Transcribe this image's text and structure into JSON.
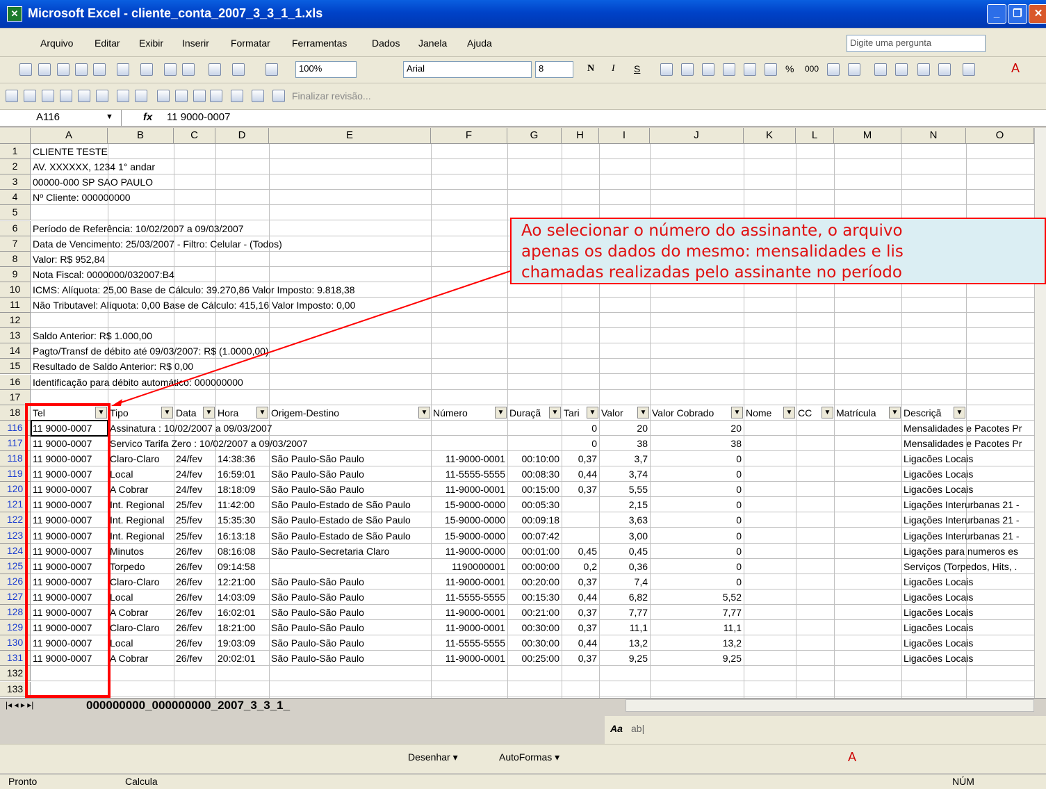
{
  "window": {
    "title": "Microsoft Excel - cliente_conta_2007_3_3_1_1.xls"
  },
  "menu": [
    "Arquivo",
    "Editar",
    "Exibir",
    "Inserir",
    "Formatar",
    "Ferramentas",
    "Dados",
    "Janela",
    "Ajuda"
  ],
  "help_placeholder": "Digite uma pergunta",
  "toolbar": {
    "zoom": "100%",
    "font": "Arial",
    "size": "8",
    "review": "Finalizar revisão..."
  },
  "formula": {
    "cell": "A116",
    "fx": "fx",
    "value": "11 9000-0007"
  },
  "columns": [
    "A",
    "B",
    "C",
    "D",
    "E",
    "F",
    "G",
    "H",
    "I",
    "J",
    "K",
    "L",
    "M",
    "N",
    "O"
  ],
  "rows": [
    {
      "n": "1",
      "a": "CLIENTE TESTE"
    },
    {
      "n": "2",
      "a": "AV. XXXXXX, 1234 1° andar"
    },
    {
      "n": "3",
      "a": "00000-000 SP SAO PAULO"
    },
    {
      "n": "4",
      "a": "Nº Cliente: 000000000"
    },
    {
      "n": "5",
      "a": ""
    },
    {
      "n": "6",
      "a": "Período de Referência: 10/02/2007 a 09/03/2007"
    },
    {
      "n": "7",
      "a": "Data de Vencimento: 25/03/2007 - Filtro: Celular - (Todos)"
    },
    {
      "n": "8",
      "a": "Valor: R$ 952,84"
    },
    {
      "n": "9",
      "a": "Nota Fiscal: 0000000/032007:B4"
    },
    {
      "n": "10",
      "a": "ICMS: Alíquota: 25,00 Base de Cálculo: 39.270,86 Valor Imposto: 9.818,38"
    },
    {
      "n": "11",
      "a": "Não Tributavel: Alíquota: 0,00 Base de Cálculo: 415,16 Valor Imposto: 0,00"
    },
    {
      "n": "12",
      "a": ""
    },
    {
      "n": "13",
      "a": "Saldo Anterior: R$ 1.000,00"
    },
    {
      "n": "14",
      "a": "Pagto/Transf de débito até 09/03/2007: R$ (1.0000,00)"
    },
    {
      "n": "15",
      "a": "Resultado de Saldo Anterior: R$ 0,00"
    },
    {
      "n": "16",
      "a": "Identificação para débito automático: 000000000"
    },
    {
      "n": "17",
      "a": ""
    }
  ],
  "header_row": {
    "n": "18",
    "cols": [
      "Tel",
      "Tipo",
      "Data",
      "Hora",
      "Origem-Destino",
      "Número",
      "Duraçã",
      "Tari",
      "Valor",
      "Valor Cobrado",
      "Nome",
      "CC",
      "Matrícula",
      "Descriçã"
    ]
  },
  "data_rows": [
    {
      "n": "116",
      "tel": "11 9000-0007",
      "tipo": "Assinatura : 10/02/2007 a 09/03/2007",
      "data": "",
      "hora": "",
      "orig": "",
      "num": "",
      "dur": "",
      "tar": "0",
      "val": "20",
      "cob": "20",
      "desc": "Mensalidades e Pacotes Pr"
    },
    {
      "n": "117",
      "tel": "11 9000-0007",
      "tipo": "Servico Tarifa Zero : 10/02/2007 a 09/03/2007",
      "data": "",
      "hora": "",
      "orig": "",
      "num": "",
      "dur": "",
      "tar": "0",
      "val": "38",
      "cob": "38",
      "desc": "Mensalidades e Pacotes Pr"
    },
    {
      "n": "118",
      "tel": "11 9000-0007",
      "tipo": "Claro-Claro",
      "data": "24/fev",
      "hora": "14:38:36",
      "orig": "São Paulo-São Paulo",
      "num": "11-9000-0001",
      "dur": "00:10:00",
      "tar": "0,37",
      "val": "3,7",
      "cob": "0",
      "desc": "Ligacões Locais"
    },
    {
      "n": "119",
      "tel": "11 9000-0007",
      "tipo": "Local",
      "data": "24/fev",
      "hora": "16:59:01",
      "orig": "São Paulo-São Paulo",
      "num": "11-5555-5555",
      "dur": "00:08:30",
      "tar": "0,44",
      "val": "3,74",
      "cob": "0",
      "desc": "Ligacões Locais"
    },
    {
      "n": "120",
      "tel": "11 9000-0007",
      "tipo": "A Cobrar",
      "data": "24/fev",
      "hora": "18:18:09",
      "orig": "São Paulo-São Paulo",
      "num": "11-9000-0001",
      "dur": "00:15:00",
      "tar": "0,37",
      "val": "5,55",
      "cob": "0",
      "desc": "Ligacões Locais"
    },
    {
      "n": "121",
      "tel": "11 9000-0007",
      "tipo": "Int. Regional",
      "data": "25/fev",
      "hora": "11:42:00",
      "orig": "São Paulo-Estado de São Paulo",
      "num": "15-9000-0000",
      "dur": "00:05:30",
      "tar": "",
      "val": "2,15",
      "cob": "0",
      "desc": "Ligações Interurbanas 21 -"
    },
    {
      "n": "122",
      "tel": "11 9000-0007",
      "tipo": "Int. Regional",
      "data": "25/fev",
      "hora": "15:35:30",
      "orig": "São Paulo-Estado de São Paulo",
      "num": "15-9000-0000",
      "dur": "00:09:18",
      "tar": "",
      "val": "3,63",
      "cob": "0",
      "desc": "Ligações Interurbanas 21 -"
    },
    {
      "n": "123",
      "tel": "11 9000-0007",
      "tipo": "Int. Regional",
      "data": "25/fev",
      "hora": "16:13:18",
      "orig": "São Paulo-Estado de São Paulo",
      "num": "15-9000-0000",
      "dur": "00:07:42",
      "tar": "",
      "val": "3,00",
      "cob": "0",
      "desc": "Ligações Interurbanas 21 -"
    },
    {
      "n": "124",
      "tel": "11 9000-0007",
      "tipo": "Minutos",
      "data": "26/fev",
      "hora": "08:16:08",
      "orig": "São Paulo-Secretaria Claro",
      "num": "11-9000-0000",
      "dur": "00:01:00",
      "tar": "0,45",
      "val": "0,45",
      "cob": "0",
      "desc": "Ligações para numeros es"
    },
    {
      "n": "125",
      "tel": "11 9000-0007",
      "tipo": "Torpedo",
      "data": "26/fev",
      "hora": "09:14:58",
      "orig": "",
      "num": "1190000001",
      "dur": "00:00:00",
      "tar": "0,2",
      "val": "0,36",
      "cob": "0",
      "desc": "Serviços (Torpedos, Hits, ."
    },
    {
      "n": "126",
      "tel": "11 9000-0007",
      "tipo": "Claro-Claro",
      "data": "26/fev",
      "hora": "12:21:00",
      "orig": "São Paulo-São Paulo",
      "num": "11-9000-0001",
      "dur": "00:20:00",
      "tar": "0,37",
      "val": "7,4",
      "cob": "0",
      "desc": "Ligacões Locais"
    },
    {
      "n": "127",
      "tel": "11 9000-0007",
      "tipo": "Local",
      "data": "26/fev",
      "hora": "14:03:09",
      "orig": "São Paulo-São Paulo",
      "num": "11-5555-5555",
      "dur": "00:15:30",
      "tar": "0,44",
      "val": "6,82",
      "cob": "5,52",
      "desc": "Ligacões Locais"
    },
    {
      "n": "128",
      "tel": "11 9000-0007",
      "tipo": "A Cobrar",
      "data": "26/fev",
      "hora": "16:02:01",
      "orig": "São Paulo-São Paulo",
      "num": "11-9000-0001",
      "dur": "00:21:00",
      "tar": "0,37",
      "val": "7,77",
      "cob": "7,77",
      "desc": "Ligacões Locais"
    },
    {
      "n": "129",
      "tel": "11 9000-0007",
      "tipo": "Claro-Claro",
      "data": "26/fev",
      "hora": "18:21:00",
      "orig": "São Paulo-São Paulo",
      "num": "11-9000-0001",
      "dur": "00:30:00",
      "tar": "0,37",
      "val": "11,1",
      "cob": "11,1",
      "desc": "Ligacões Locais"
    },
    {
      "n": "130",
      "tel": "11 9000-0007",
      "tipo": "Local",
      "data": "26/fev",
      "hora": "19:03:09",
      "orig": "São Paulo-São Paulo",
      "num": "11-5555-5555",
      "dur": "00:30:00",
      "tar": "0,44",
      "val": "13,2",
      "cob": "13,2",
      "desc": "Ligacões Locais"
    },
    {
      "n": "131",
      "tel": "11 9000-0007",
      "tipo": "A Cobrar",
      "data": "26/fev",
      "hora": "20:02:01",
      "orig": "São Paulo-São Paulo",
      "num": "11-9000-0001",
      "dur": "00:25:00",
      "tar": "0,37",
      "val": "9,25",
      "cob": "9,25",
      "desc": "Ligacões Locais"
    }
  ],
  "empty_rows": [
    "132",
    "133"
  ],
  "sheet_tab": "000000000_000000000_2007_3_3_1_",
  "drawbar": {
    "desenhar": "Desenhar ▾",
    "autoformas": "AutoFormas ▾"
  },
  "status": {
    "left": "Pronto",
    "calc": "Calcula",
    "num": "NÚM"
  },
  "callout": [
    "Ao selecionar o número do assinante, o arquivo",
    "apenas os dados do mesmo: mensalidades e lis",
    "chamadas realizadas pelo assinante no período"
  ]
}
